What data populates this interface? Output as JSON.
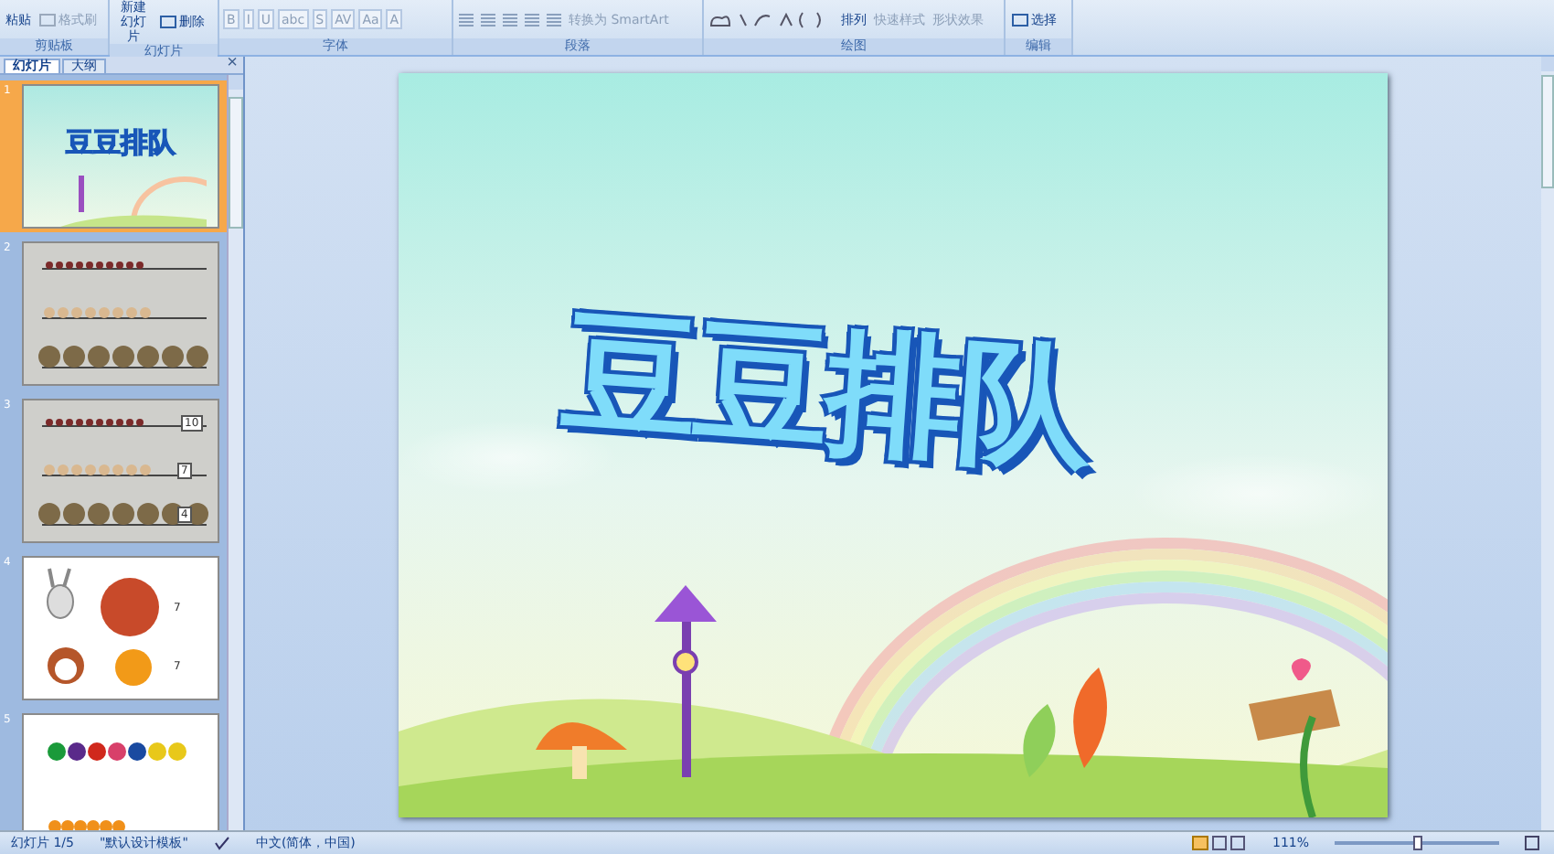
{
  "ribbon": {
    "groups": [
      {
        "kind": "clipboard",
        "label": "剪贴板",
        "buttons": [
          {
            "label": "粘贴",
            "disabled": false
          },
          {
            "label": "格式刷",
            "disabled": true
          }
        ]
      },
      {
        "kind": "slides",
        "label": "幻灯片",
        "buttons": [
          {
            "label": "新建幻灯片",
            "disabled": false
          },
          {
            "label": "删除",
            "disabled": false
          }
        ]
      },
      {
        "kind": "font",
        "label": "字体",
        "buttons": [
          {
            "label": "B",
            "disabled": true
          },
          {
            "label": "I",
            "disabled": true
          },
          {
            "label": "U",
            "disabled": true
          },
          {
            "label": "abc",
            "disabled": true
          },
          {
            "label": "S",
            "disabled": true
          },
          {
            "label": "AV",
            "disabled": true
          },
          {
            "label": "Aa",
            "disabled": true
          },
          {
            "label": "A",
            "disabled": true
          }
        ]
      },
      {
        "kind": "paragraph",
        "label": "段落",
        "buttons": [
          {
            "label": "转换为 SmartArt",
            "disabled": true
          }
        ]
      },
      {
        "kind": "drawing",
        "label": "绘图",
        "buttons": [
          {
            "label": "排列",
            "disabled": false
          },
          {
            "label": "快速样式",
            "disabled": true
          },
          {
            "label": "形状效果",
            "disabled": true
          }
        ]
      },
      {
        "kind": "editing",
        "label": "编辑",
        "buttons": [
          {
            "label": "选择",
            "disabled": false
          }
        ]
      }
    ]
  },
  "panel": {
    "tabs": [
      {
        "label": "幻灯片",
        "selected": true
      },
      {
        "label": "大纲",
        "selected": false
      }
    ],
    "close": "×",
    "thumbnails": [
      {
        "number": "1",
        "kind": "title",
        "selected": true,
        "labels": [
          "豆豆排队"
        ]
      },
      {
        "number": "2",
        "kind": "beans",
        "selected": false
      },
      {
        "number": "3",
        "kind": "beans",
        "selected": false,
        "labels": [
          "10",
          "7",
          "4"
        ]
      },
      {
        "number": "4",
        "kind": "animals",
        "selected": false,
        "labels": [
          "7",
          "7"
        ]
      },
      {
        "number": "5",
        "kind": "colors",
        "selected": false
      }
    ]
  },
  "slide": {
    "title": "豆豆排队"
  },
  "status_bar": {
    "slide_info": "幻灯片 1/5",
    "theme": "\"默认设计模板\"",
    "language": "中文(简体，中国)",
    "zoom": "111%",
    "zoom_slider": {
      "level": 0.5
    }
  }
}
